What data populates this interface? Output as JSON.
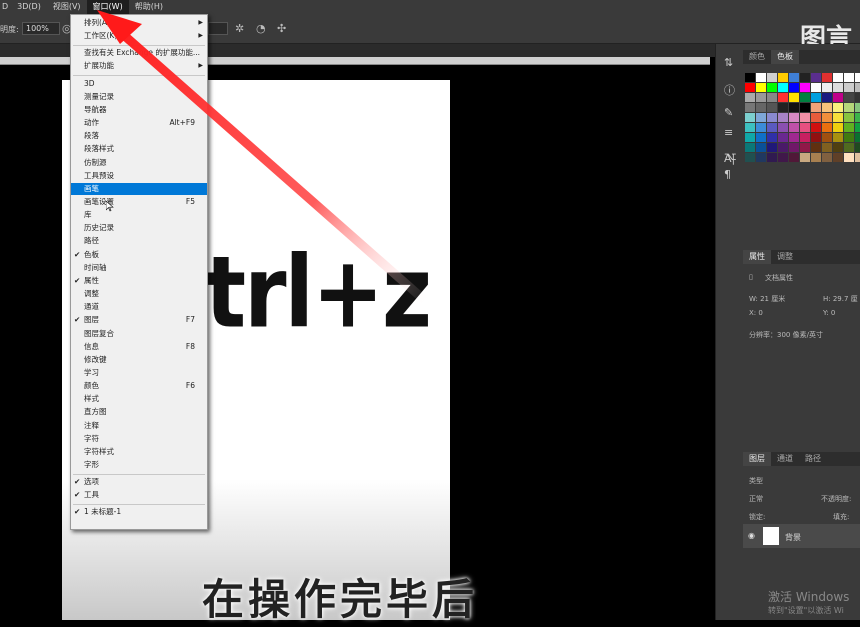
{
  "menubar": {
    "items": [
      "3D(D)",
      "视图(V)",
      "窗口(W)",
      "帮助(H)"
    ],
    "active": "窗口(W)",
    "partial_left": "D"
  },
  "options_bar": {
    "label": "明度:",
    "zoom": "100%"
  },
  "window_menu": {
    "items": [
      {
        "label": "排列(A)",
        "submenu": true
      },
      {
        "label": "工作区(K)",
        "submenu": true
      },
      {
        "label": "查找有关 Exchange 的扩展功能..."
      },
      {
        "label": "扩展功能",
        "submenu": true
      },
      {
        "label": "3D"
      },
      {
        "label": "测量记录"
      },
      {
        "label": "导航器"
      },
      {
        "label": "动作",
        "shortcut": "Alt+F9"
      },
      {
        "label": "段落"
      },
      {
        "label": "段落样式"
      },
      {
        "label": "仿制源"
      },
      {
        "label": "工具预设"
      },
      {
        "label": "画笔",
        "highlighted": true
      },
      {
        "label": "画笔设置",
        "shortcut": "F5"
      },
      {
        "label": "库"
      },
      {
        "label": "历史记录"
      },
      {
        "label": "路径"
      },
      {
        "label": "色板",
        "checked": true
      },
      {
        "label": "时间轴"
      },
      {
        "label": "属性",
        "checked": true
      },
      {
        "label": "调整"
      },
      {
        "label": "通道"
      },
      {
        "label": "图层",
        "checked": true,
        "shortcut": "F7"
      },
      {
        "label": "图层复合"
      },
      {
        "label": "信息",
        "shortcut": "F8"
      },
      {
        "label": "修改键"
      },
      {
        "label": "学习"
      },
      {
        "label": "颜色",
        "shortcut": "F6"
      },
      {
        "label": "样式"
      },
      {
        "label": "直方图"
      },
      {
        "label": "注释"
      },
      {
        "label": "字符"
      },
      {
        "label": "字符样式"
      },
      {
        "label": "字形"
      },
      {
        "label": "选项",
        "checked": true
      },
      {
        "label": "工具",
        "checked": true
      },
      {
        "label": "1 未标题-1",
        "checked": true
      }
    ]
  },
  "canvas": {
    "handwriting": "trl+z",
    "subtitle": "在操作完毕后"
  },
  "right_panel": {
    "top_tabs": [
      "颜色",
      "色板"
    ],
    "active_top_tab": "色板",
    "props_tabs": [
      "属性",
      "调整"
    ],
    "doc_props_label": "文档属性",
    "w_label": "W: 21 厘米",
    "h_label": "H: 29.7 厘",
    "x_label": "X: 0",
    "y_label": "Y: 0",
    "resolution": "分辨率：300 像素/英寸",
    "layers_tabs": [
      "图层",
      "通道",
      "路径"
    ],
    "layer_kind": "类型",
    "blend_mode": "正常",
    "opacity": "不透明度:",
    "lock_label": "锁定:",
    "fill": "填充:",
    "layer_name": "背景"
  },
  "watermark": {
    "line1": "激活 Windows",
    "line2": "转到\"设置\"以激活 Wi"
  },
  "logo": "图言",
  "colors": {
    "menu_highlight": "#0078d7",
    "arrow": "#ff2020"
  }
}
